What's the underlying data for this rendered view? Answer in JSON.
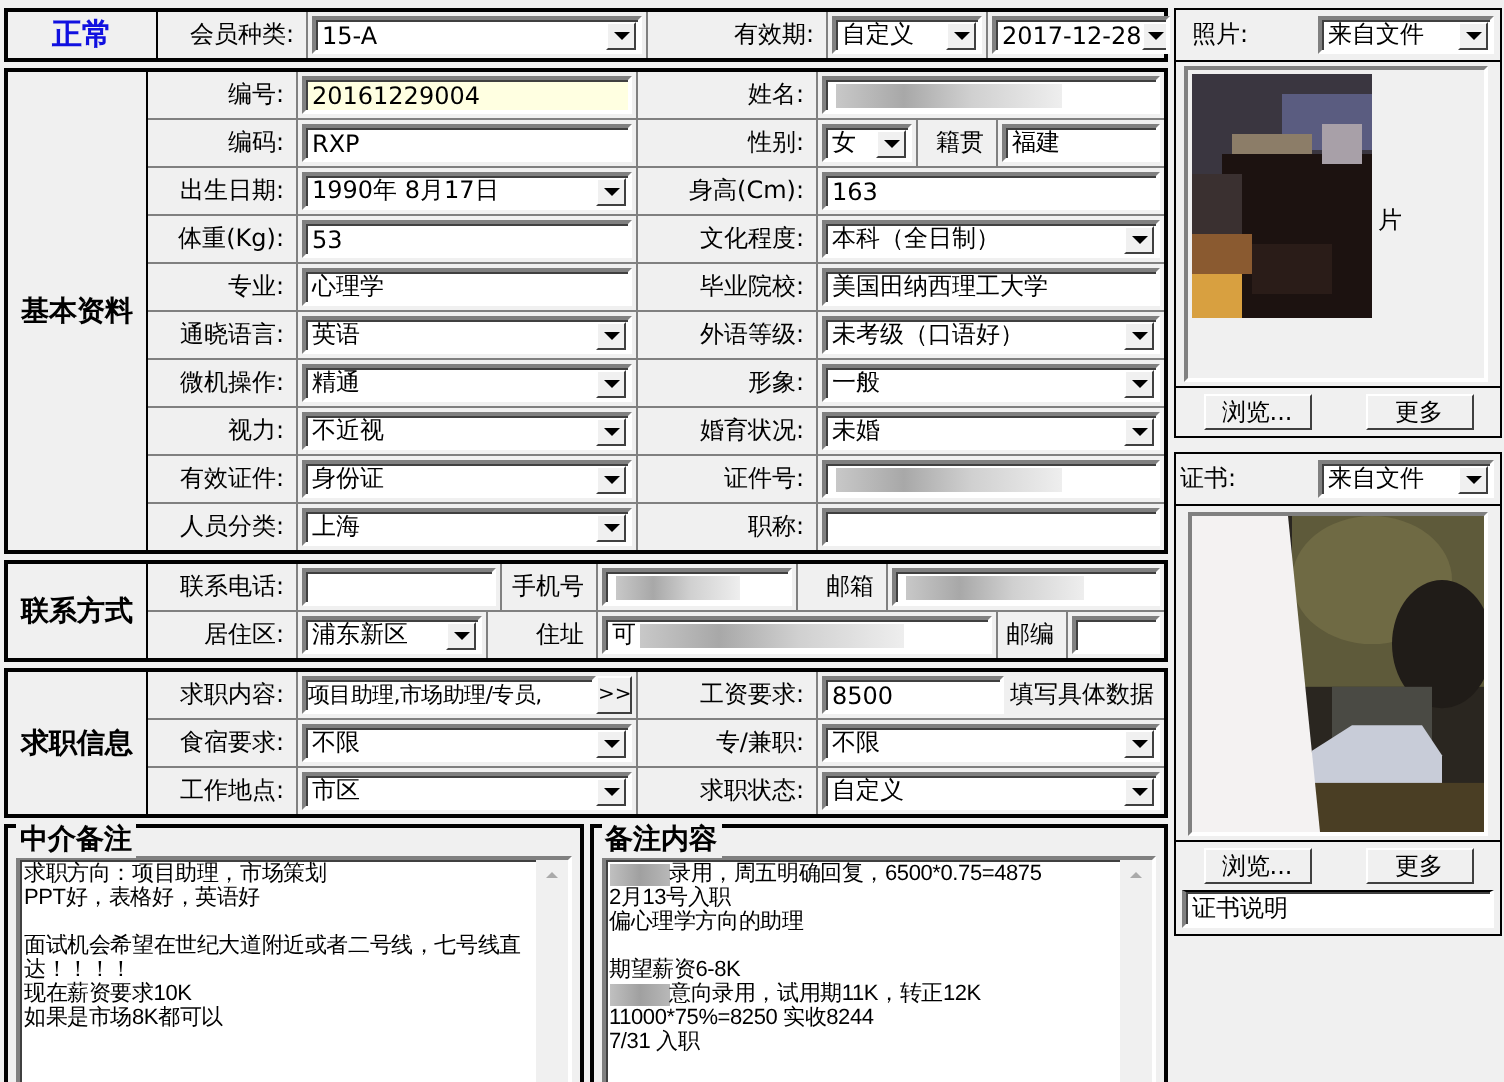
{
  "top": {
    "cells": [
      {
        "kind": "status",
        "text": "正常"
      },
      {
        "kind": "label",
        "text": "会员种类:"
      },
      {
        "kind": "select",
        "value": "15-A"
      },
      {
        "kind": "label",
        "text": "有效期:"
      },
      {
        "kind": "select",
        "value": "自定义"
      },
      {
        "kind": "select",
        "value": "2017-12-28"
      }
    ]
  },
  "sections": [
    {
      "title": "基本资料",
      "rows": [
        {
          "cells": [
            {
              "kind": "label",
              "text": "编号:"
            },
            {
              "kind": "text",
              "value": "20161229004",
              "highlight": true
            },
            {
              "kind": "label",
              "text": "姓名:"
            },
            {
              "kind": "redacted"
            }
          ]
        },
        {
          "cells": [
            {
              "kind": "label",
              "text": "编码:"
            },
            {
              "kind": "text",
              "value": "RXP",
              "highlight": false
            },
            {
              "kind": "label",
              "text": "性别:"
            },
            {
              "kind": "select",
              "value": "女"
            },
            {
              "kind": "label",
              "text": "籍贯"
            },
            {
              "kind": "text",
              "value": "福建",
              "highlight": false
            }
          ]
        },
        {
          "cells": [
            {
              "kind": "label",
              "text": "出生日期:"
            },
            {
              "kind": "select",
              "value": "1990年 8月17日"
            },
            {
              "kind": "label",
              "text": "身高(Cm):"
            },
            {
              "kind": "text",
              "value": "163",
              "highlight": false
            }
          ]
        },
        {
          "cells": [
            {
              "kind": "label",
              "text": "体重(Kg):"
            },
            {
              "kind": "text",
              "value": "53",
              "highlight": false
            },
            {
              "kind": "label",
              "text": "文化程度:"
            },
            {
              "kind": "select",
              "value": "本科（全日制）"
            }
          ]
        },
        {
          "cells": [
            {
              "kind": "label",
              "text": "专业:"
            },
            {
              "kind": "text",
              "value": "心理学",
              "highlight": false
            },
            {
              "kind": "label",
              "text": "毕业院校:"
            },
            {
              "kind": "text",
              "value": "美国田纳西理工大学",
              "highlight": false
            }
          ]
        },
        {
          "cells": [
            {
              "kind": "label",
              "text": "通晓语言:"
            },
            {
              "kind": "select",
              "value": "英语"
            },
            {
              "kind": "label",
              "text": "外语等级:"
            },
            {
              "kind": "select",
              "value": "未考级（口语好）"
            }
          ]
        },
        {
          "cells": [
            {
              "kind": "label",
              "text": "微机操作:"
            },
            {
              "kind": "select",
              "value": "精通"
            },
            {
              "kind": "label",
              "text": "形象:"
            },
            {
              "kind": "select",
              "value": "一般"
            }
          ]
        },
        {
          "cells": [
            {
              "kind": "label",
              "text": "视力:"
            },
            {
              "kind": "select",
              "value": "不近视"
            },
            {
              "kind": "label",
              "text": "婚育状况:"
            },
            {
              "kind": "select",
              "value": "未婚"
            }
          ]
        },
        {
          "cells": [
            {
              "kind": "label",
              "text": "有效证件:"
            },
            {
              "kind": "select",
              "value": "身份证"
            },
            {
              "kind": "label",
              "text": "证件号:"
            },
            {
              "kind": "redacted"
            }
          ]
        },
        {
          "cells": [
            {
              "kind": "label",
              "text": "人员分类:"
            },
            {
              "kind": "select",
              "value": "上海"
            },
            {
              "kind": "label",
              "text": "职称:"
            },
            {
              "kind": "text",
              "highlight": false
            }
          ]
        }
      ]
    },
    {
      "title": "联系方式",
      "rows": [
        {
          "cells": [
            {
              "kind": "label",
              "text": "联系电话:"
            },
            {
              "kind": "text",
              "highlight": false
            },
            {
              "kind": "label",
              "text": "手机号"
            },
            {
              "kind": "redacted"
            },
            {
              "kind": "label",
              "text": "邮箱"
            },
            {
              "kind": "redacted"
            }
          ]
        },
        {
          "cells": [
            {
              "kind": "label",
              "text": "居住区:"
            },
            {
              "kind": "select",
              "value": "浦东新区"
            },
            {
              "kind": "label",
              "text": "住址"
            },
            {
              "kind": "redacted",
              "value": "可"
            },
            {
              "kind": "label",
              "text": "邮编"
            },
            {
              "kind": "text",
              "highlight": false
            }
          ]
        }
      ]
    },
    {
      "title": "求职信息",
      "rows": [
        {
          "cells": [
            {
              "kind": "label",
              "text": "求职内容:"
            },
            {
              "kind": "more",
              "value": "项目助理,市场助理/专员,",
              "button": ">>"
            },
            {
              "kind": "label",
              "text": "工资要求:"
            },
            {
              "kind": "text",
              "value": "8500",
              "highlight": false
            },
            {
              "kind": "hint",
              "text": "填写具体数据"
            }
          ]
        },
        {
          "cells": [
            {
              "kind": "label",
              "text": "食宿要求:"
            },
            {
              "kind": "select",
              "value": "不限"
            },
            {
              "kind": "label",
              "text": "专/兼职:"
            },
            {
              "kind": "select",
              "value": "不限"
            }
          ]
        },
        {
          "cells": [
            {
              "kind": "label",
              "text": "工作地点:"
            },
            {
              "kind": "select",
              "value": "市区"
            },
            {
              "kind": "label",
              "text": "求职状态:"
            },
            {
              "kind": "select",
              "value": "自定义"
            }
          ]
        }
      ]
    }
  ],
  "notes": [
    {
      "title": "中介备注",
      "lines": [
        {
          "text": "求职方向：项目助理，市场策划",
          "gap_before": false,
          "redacted_prefix": false
        },
        {
          "text": "PPT好，表格好，英语好",
          "gap_before": false,
          "redacted_prefix": false
        },
        {
          "text": "面试机会希望在世纪大道附近或者二号线，七号线直达！！！！",
          "gap_before": true,
          "redacted_prefix": false
        },
        {
          "text": "现在薪资要求10K",
          "gap_before": false,
          "redacted_prefix": false
        },
        {
          "text": "如果是市场8K都可以",
          "gap_before": false,
          "redacted_prefix": false
        }
      ]
    },
    {
      "title": "备注内容",
      "lines": [
        {
          "text": "录用，周五明确回复，6500*0.75=4875",
          "gap_before": false,
          "redacted_prefix": true
        },
        {
          "text": "2月13号入职",
          "gap_before": false,
          "redacted_prefix": false
        },
        {
          "text": "偏心理学方向的助理",
          "gap_before": false,
          "redacted_prefix": false
        },
        {
          "text": "期望薪资6-8K",
          "gap_before": true,
          "redacted_prefix": false
        },
        {
          "text": "意向录用，试用期11K，转正12K",
          "gap_before": false,
          "redacted_prefix": true
        },
        {
          "text": "11000*75%=8250 实收8244",
          "gap_before": false,
          "redacted_prefix": false
        },
        {
          "text": "7/31 入职",
          "gap_before": false,
          "redacted_prefix": false
        }
      ]
    }
  ],
  "photo": {
    "label": "照片:",
    "source": "来自文件",
    "alt_text": "片",
    "buttons": [
      "浏览...",
      "更多"
    ]
  },
  "certificate": {
    "label": "证书:",
    "source": "来自文件",
    "buttons": [
      "浏览...",
      "更多"
    ],
    "caption": "证书说明"
  }
}
